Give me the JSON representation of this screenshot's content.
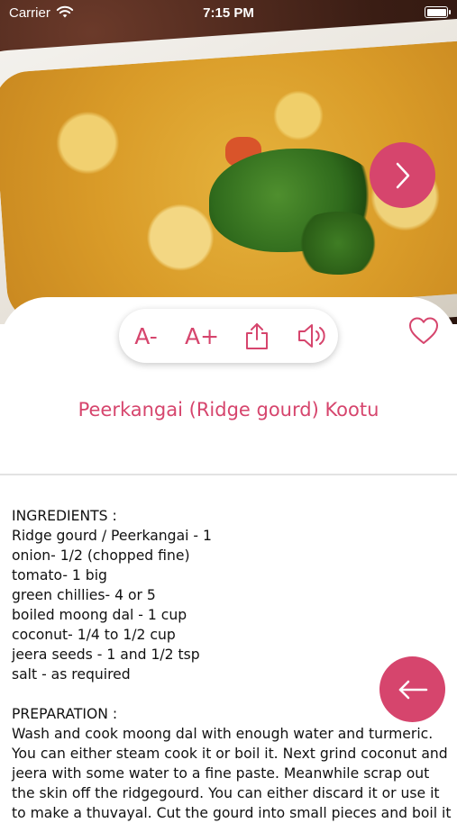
{
  "status_bar": {
    "carrier": "Carrier",
    "time": "7:15 PM"
  },
  "recipe": {
    "title": "Peerkangai (Ridge gourd) Kootu",
    "ingredients_heading": "INGREDIENTS :",
    "ingredients": [
      "Ridge gourd / Peerkangai - 1",
      "onion- 1/2 (chopped fine)",
      "tomato- 1 big",
      "green chillies- 4 or 5",
      "boiled moong dal - 1 cup",
      "coconut- 1/4 to 1/2 cup",
      "jeera seeds - 1 and 1/2 tsp",
      "salt - as required"
    ],
    "preparation_heading": "PREPARATION :",
    "preparation_lines": [
      "Wash and cook moong dal with enough water and turmeric.",
      "You can either steam cook it or boil it. Next grind coconut and",
      "jeera with some water to a fine paste. Meanwhile scrap out",
      "the skin off the ridgegourd. You can either discard it or use it",
      "to make a thuvayal. Cut the gourd into small pieces and boil it"
    ]
  },
  "toolbar": {
    "decrease_font_label": "A-",
    "increase_font_label": "A+"
  },
  "icons": {
    "next": "chevron-right-icon",
    "back": "arrow-left-icon",
    "share": "share-icon",
    "speaker": "speaker-icon",
    "favorite": "heart-icon"
  },
  "colors": {
    "accent": "#d6456d"
  }
}
